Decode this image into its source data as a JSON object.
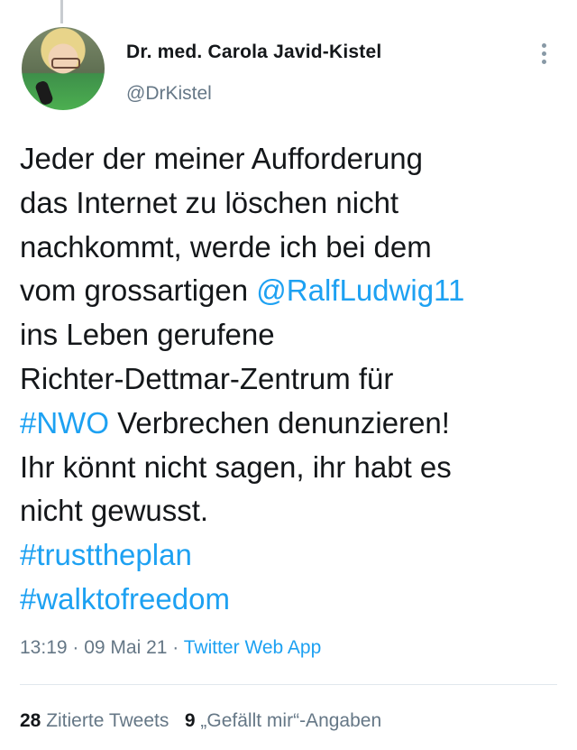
{
  "author": {
    "name": "Dr. med. Carola Javid-Kistel",
    "handle": "@DrKistel"
  },
  "tweet": {
    "line1": "Jeder der meiner Aufforderung",
    "line2": "das Internet zu löschen nicht",
    "line3": "nachkommt, werde ich bei dem",
    "line4_text": "vom grossartigen ",
    "line4_mention": "@RalfLudwig11",
    "line5": "ins Leben gerufene",
    "line6": "Richter-Dettmar-Zentrum für",
    "line7_hashtag": "#NWO",
    "line7_text": " Verbrechen denunzieren!",
    "line8": "Ihr könnt nicht sagen, ihr habt es",
    "line9": "nicht gewusst.",
    "hashtag1": "#trusttheplan",
    "hashtag2": "#walktofreedom"
  },
  "meta": {
    "time": "13:19",
    "sep1": " · ",
    "date": "09 Mai 21",
    "sep2": " · ",
    "app": "Twitter Web App"
  },
  "stats": {
    "quotes_count": "28",
    "quotes_label": " Zitierte Tweets",
    "likes_count": "9",
    "likes_label": " „Gefällt mir“-Angaben"
  },
  "colors": {
    "link": "#1da1f2",
    "secondary": "#657786",
    "text": "#14171a"
  },
  "icons": {
    "more": "more-vertical-icon"
  }
}
